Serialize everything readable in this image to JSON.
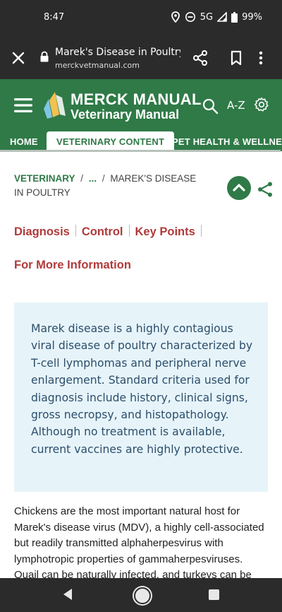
{
  "status": {
    "time": "8:47",
    "network": "5G",
    "battery": "99%"
  },
  "browser": {
    "tab_title": "Marek's Disease in Poultry - ...",
    "url": "merckvetmanual.com"
  },
  "header": {
    "brand_line1": "MERCK MANUAL",
    "brand_line2": "Veterinary Manual",
    "az_label": "A-Z",
    "brand_color": "#2f7a47"
  },
  "nav": {
    "tabs": [
      {
        "label": "HOME"
      },
      {
        "label": "VETERINARY CONTENT"
      },
      {
        "label": "PET HEALTH & WELLNESS"
      }
    ]
  },
  "breadcrumb": {
    "root": "VETERINARY",
    "ellipsis": "...",
    "separator": "/",
    "current": "MAREK'S DISEASE IN POULTRY"
  },
  "toc": {
    "items": [
      {
        "label": "Diagnosis"
      },
      {
        "label": "Control"
      },
      {
        "label": "Key Points"
      },
      {
        "label": "For More Information"
      }
    ]
  },
  "summary": {
    "text": "Marek disease is a highly contagious viral disease of poultry characterized by T-cell lymphomas and peripheral nerve enlargement. Standard criteria used for diagnosis include history, clinical signs, gross necropsy, and histopathology. Although no treatment is available, current vaccines are highly protective."
  },
  "body": {
    "paragraph": "Chickens are the most important natural host for Marek's disease virus (MDV), a highly cell-associated but readily transmitted alphaherpesvirus with lymphotropic properties of gammaherpesviruses. Quail can be naturally infected, and turkeys can be"
  }
}
